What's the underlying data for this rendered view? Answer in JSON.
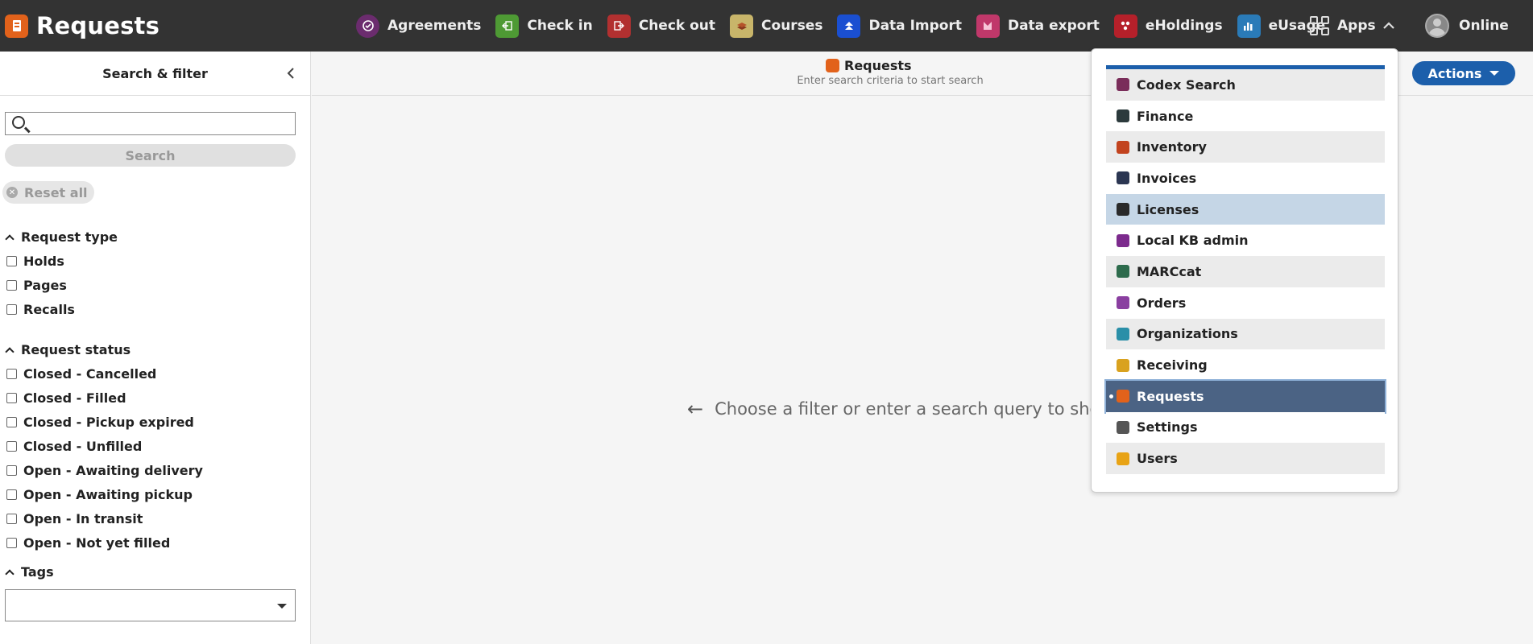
{
  "app": {
    "title": "Requests"
  },
  "nav": {
    "items": [
      {
        "label": "Agreements",
        "icon": "agreements-icon",
        "color": "#6b2c6e"
      },
      {
        "label": "Check in",
        "icon": "check-in-icon",
        "color": "#4e9a34"
      },
      {
        "label": "Check out",
        "icon": "check-out-icon",
        "color": "#b23030"
      },
      {
        "label": "Courses",
        "icon": "courses-icon",
        "color": "#c8b56a"
      },
      {
        "label": "Data Import",
        "icon": "data-import-icon",
        "color": "#1a4fd1"
      },
      {
        "label": "Data export",
        "icon": "data-export-icon",
        "color": "#c0386a"
      },
      {
        "label": "eHoldings",
        "icon": "eholdings-icon",
        "color": "#b5202a"
      },
      {
        "label": "eUsage",
        "icon": "eusage-icon",
        "color": "#2a7bb8"
      }
    ],
    "apps_label": "Apps",
    "profile_label": "Online"
  },
  "filter_pane": {
    "title": "Search & filter",
    "search_placeholder": "",
    "search_button": "Search",
    "reset_button": "Reset all",
    "request_type": {
      "heading": "Request type",
      "options": [
        "Holds",
        "Pages",
        "Recalls"
      ]
    },
    "request_status": {
      "heading": "Request status",
      "options": [
        "Closed - Cancelled",
        "Closed - Filled",
        "Closed - Pickup expired",
        "Closed - Unfilled",
        "Open - Awaiting delivery",
        "Open - Awaiting pickup",
        "Open - In transit",
        "Open - Not yet filled"
      ]
    },
    "tags": {
      "heading": "Tags"
    }
  },
  "results": {
    "title": "Requests",
    "subtitle": "Enter search criteria to start search",
    "actions_button": "Actions",
    "empty_message": "Choose a filter or enter a search query to show"
  },
  "apps_menu": {
    "items": [
      {
        "label": "Codex Search",
        "icon_color": "#7a2d5a"
      },
      {
        "label": "Finance",
        "icon_color": "#2c3a3c"
      },
      {
        "label": "Inventory",
        "icon_color": "#c2431e"
      },
      {
        "label": "Invoices",
        "icon_color": "#2b3652"
      },
      {
        "label": "Licenses",
        "icon_color": "#2a2a2a"
      },
      {
        "label": "Local KB admin",
        "icon_color": "#7c2a8d"
      },
      {
        "label": "MARCcat",
        "icon_color": "#2d6b4c"
      },
      {
        "label": "Orders",
        "icon_color": "#8a3fa0"
      },
      {
        "label": "Organizations",
        "icon_color": "#2a8fa8"
      },
      {
        "label": "Receiving",
        "icon_color": "#d9a21f"
      },
      {
        "label": "Requests",
        "icon_color": "#e2621b"
      },
      {
        "label": "Settings",
        "icon_color": "#555555"
      },
      {
        "label": "Users",
        "icon_color": "#e8a315"
      }
    ]
  }
}
